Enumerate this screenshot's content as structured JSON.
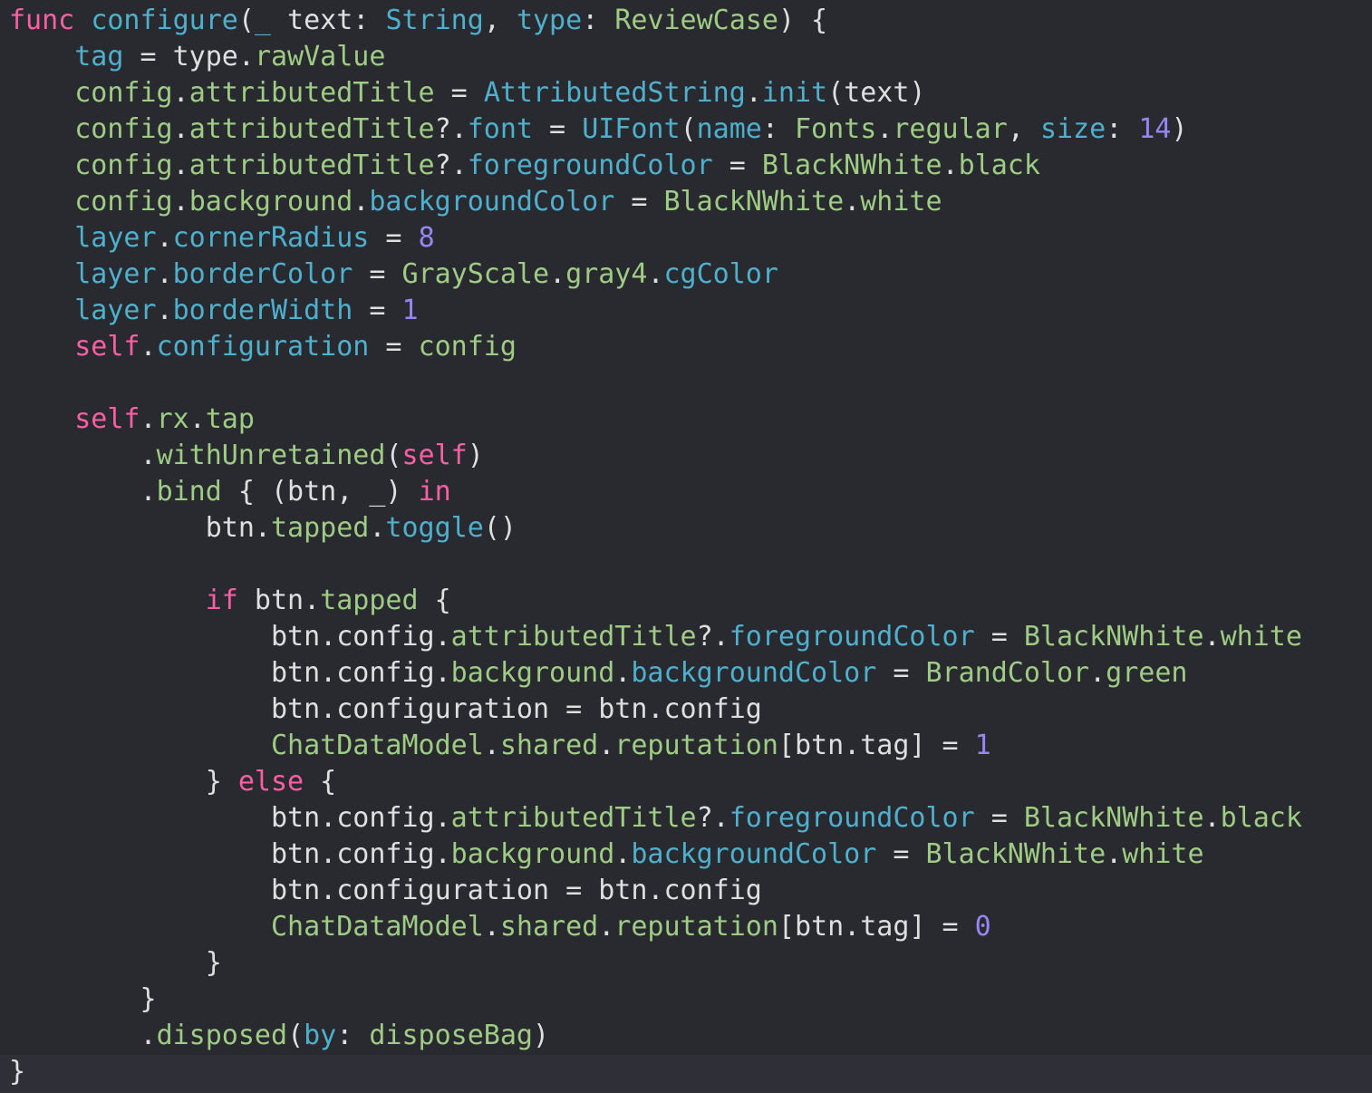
{
  "editor": {
    "theme": {
      "background": "#292a30",
      "current_line": "#2f3037",
      "plain": "#dfdfe0",
      "keyword": "#fc5fa3",
      "type_decl": "#5dd8ff",
      "function_decl": "#41a1c0",
      "property_project": "#67b7a4",
      "other_type": "#a1d28c",
      "property_other": "#a8d7c9",
      "number": "#d0bf69"
    },
    "lines": [
      [
        {
          "c": "kw",
          "t": "func"
        },
        {
          "c": "plain",
          "t": " "
        },
        {
          "c": "fn",
          "t": "configure"
        },
        {
          "c": "plain",
          "t": "("
        },
        {
          "c": "fn",
          "t": "_"
        },
        {
          "c": "plain",
          "t": " text: "
        },
        {
          "c": "type",
          "t": "String"
        },
        {
          "c": "plain",
          "t": ", "
        },
        {
          "c": "fn",
          "t": "type"
        },
        {
          "c": "plain",
          "t": ": "
        },
        {
          "c": "ot",
          "t": "ReviewCase"
        },
        {
          "c": "plain",
          "t": ") {"
        }
      ],
      [
        {
          "c": "plain",
          "t": "    "
        },
        {
          "c": "fn",
          "t": "tag"
        },
        {
          "c": "plain",
          "t": " = type."
        },
        {
          "c": "po",
          "t": "rawValue"
        }
      ],
      [
        {
          "c": "plain",
          "t": "    "
        },
        {
          "c": "po",
          "t": "config"
        },
        {
          "c": "plain",
          "t": "."
        },
        {
          "c": "po",
          "t": "attributedTitle"
        },
        {
          "c": "plain",
          "t": " = "
        },
        {
          "c": "fn",
          "t": "AttributedString"
        },
        {
          "c": "plain",
          "t": "."
        },
        {
          "c": "fn",
          "t": "init"
        },
        {
          "c": "plain",
          "t": "(text)"
        }
      ],
      [
        {
          "c": "plain",
          "t": "    "
        },
        {
          "c": "po",
          "t": "config"
        },
        {
          "c": "plain",
          "t": "."
        },
        {
          "c": "po",
          "t": "attributedTitle"
        },
        {
          "c": "plain",
          "t": "?."
        },
        {
          "c": "fn",
          "t": "font"
        },
        {
          "c": "plain",
          "t": " = "
        },
        {
          "c": "fn",
          "t": "UIFont"
        },
        {
          "c": "plain",
          "t": "("
        },
        {
          "c": "fn",
          "t": "name"
        },
        {
          "c": "plain",
          "t": ": "
        },
        {
          "c": "ot",
          "t": "Fonts"
        },
        {
          "c": "plain",
          "t": "."
        },
        {
          "c": "po",
          "t": "regular"
        },
        {
          "c": "plain",
          "t": ", "
        },
        {
          "c": "fn",
          "t": "size"
        },
        {
          "c": "plain",
          "t": ": "
        },
        {
          "c": "num",
          "t": "14"
        },
        {
          "c": "plain",
          "t": ")"
        }
      ],
      [
        {
          "c": "plain",
          "t": "    "
        },
        {
          "c": "po",
          "t": "config"
        },
        {
          "c": "plain",
          "t": "."
        },
        {
          "c": "po",
          "t": "attributedTitle"
        },
        {
          "c": "plain",
          "t": "?."
        },
        {
          "c": "fn",
          "t": "foregroundColor"
        },
        {
          "c": "plain",
          "t": " = "
        },
        {
          "c": "ot",
          "t": "BlackNWhite"
        },
        {
          "c": "plain",
          "t": "."
        },
        {
          "c": "po",
          "t": "black"
        }
      ],
      [
        {
          "c": "plain",
          "t": "    "
        },
        {
          "c": "po",
          "t": "config"
        },
        {
          "c": "plain",
          "t": "."
        },
        {
          "c": "po",
          "t": "background"
        },
        {
          "c": "plain",
          "t": "."
        },
        {
          "c": "fn",
          "t": "backgroundColor"
        },
        {
          "c": "plain",
          "t": " = "
        },
        {
          "c": "ot",
          "t": "BlackNWhite"
        },
        {
          "c": "plain",
          "t": "."
        },
        {
          "c": "po",
          "t": "white"
        }
      ],
      [
        {
          "c": "plain",
          "t": "    "
        },
        {
          "c": "fn",
          "t": "layer"
        },
        {
          "c": "plain",
          "t": "."
        },
        {
          "c": "fn",
          "t": "cornerRadius"
        },
        {
          "c": "plain",
          "t": " = "
        },
        {
          "c": "num",
          "t": "8"
        }
      ],
      [
        {
          "c": "plain",
          "t": "    "
        },
        {
          "c": "fn",
          "t": "layer"
        },
        {
          "c": "plain",
          "t": "."
        },
        {
          "c": "fn",
          "t": "borderColor"
        },
        {
          "c": "plain",
          "t": " = "
        },
        {
          "c": "ot",
          "t": "GrayScale"
        },
        {
          "c": "plain",
          "t": "."
        },
        {
          "c": "po",
          "t": "gray4"
        },
        {
          "c": "plain",
          "t": "."
        },
        {
          "c": "fn",
          "t": "cgColor"
        }
      ],
      [
        {
          "c": "plain",
          "t": "    "
        },
        {
          "c": "fn",
          "t": "layer"
        },
        {
          "c": "plain",
          "t": "."
        },
        {
          "c": "fn",
          "t": "borderWidth"
        },
        {
          "c": "plain",
          "t": " = "
        },
        {
          "c": "num",
          "t": "1"
        }
      ],
      [
        {
          "c": "plain",
          "t": "    "
        },
        {
          "c": "kw",
          "t": "self"
        },
        {
          "c": "plain",
          "t": "."
        },
        {
          "c": "fn",
          "t": "configuration"
        },
        {
          "c": "plain",
          "t": " = "
        },
        {
          "c": "po",
          "t": "config"
        }
      ],
      [
        {
          "c": "plain",
          "t": ""
        }
      ],
      [
        {
          "c": "plain",
          "t": "    "
        },
        {
          "c": "kw",
          "t": "self"
        },
        {
          "c": "plain",
          "t": "."
        },
        {
          "c": "po",
          "t": "rx"
        },
        {
          "c": "plain",
          "t": "."
        },
        {
          "c": "po",
          "t": "tap"
        }
      ],
      [
        {
          "c": "plain",
          "t": "        ."
        },
        {
          "c": "po",
          "t": "withUnretained"
        },
        {
          "c": "plain",
          "t": "("
        },
        {
          "c": "kw",
          "t": "self"
        },
        {
          "c": "plain",
          "t": ")"
        }
      ],
      [
        {
          "c": "plain",
          "t": "        ."
        },
        {
          "c": "po",
          "t": "bind"
        },
        {
          "c": "plain",
          "t": " { (btn, _) "
        },
        {
          "c": "kw",
          "t": "in"
        }
      ],
      [
        {
          "c": "plain",
          "t": "            btn."
        },
        {
          "c": "po",
          "t": "tapped"
        },
        {
          "c": "plain",
          "t": "."
        },
        {
          "c": "fn",
          "t": "toggle"
        },
        {
          "c": "plain",
          "t": "()"
        }
      ],
      [
        {
          "c": "plain",
          "t": ""
        }
      ],
      [
        {
          "c": "plain",
          "t": "            "
        },
        {
          "c": "kw",
          "t": "if"
        },
        {
          "c": "plain",
          "t": " btn."
        },
        {
          "c": "po",
          "t": "tapped"
        },
        {
          "c": "plain",
          "t": " {"
        }
      ],
      [
        {
          "c": "plain",
          "t": "                btn.config."
        },
        {
          "c": "po",
          "t": "attributedTitle"
        },
        {
          "c": "plain",
          "t": "?."
        },
        {
          "c": "fn",
          "t": "foregroundColor"
        },
        {
          "c": "plain",
          "t": " = "
        },
        {
          "c": "ot",
          "t": "BlackNWhite"
        },
        {
          "c": "plain",
          "t": "."
        },
        {
          "c": "po",
          "t": "white"
        }
      ],
      [
        {
          "c": "plain",
          "t": "                btn.config."
        },
        {
          "c": "po",
          "t": "background"
        },
        {
          "c": "plain",
          "t": "."
        },
        {
          "c": "fn",
          "t": "backgroundColor"
        },
        {
          "c": "plain",
          "t": " = "
        },
        {
          "c": "ot",
          "t": "BrandColor"
        },
        {
          "c": "plain",
          "t": "."
        },
        {
          "c": "po",
          "t": "green"
        }
      ],
      [
        {
          "c": "plain",
          "t": "                btn.configuration = btn.config"
        }
      ],
      [
        {
          "c": "plain",
          "t": "                "
        },
        {
          "c": "ot",
          "t": "ChatDataModel"
        },
        {
          "c": "plain",
          "t": "."
        },
        {
          "c": "po",
          "t": "shared"
        },
        {
          "c": "plain",
          "t": "."
        },
        {
          "c": "po",
          "t": "reputation"
        },
        {
          "c": "plain",
          "t": "[btn.tag] = "
        },
        {
          "c": "num",
          "t": "1"
        }
      ],
      [
        {
          "c": "plain",
          "t": "            } "
        },
        {
          "c": "kw",
          "t": "else"
        },
        {
          "c": "plain",
          "t": " {"
        }
      ],
      [
        {
          "c": "plain",
          "t": "                btn.config."
        },
        {
          "c": "po",
          "t": "attributedTitle"
        },
        {
          "c": "plain",
          "t": "?."
        },
        {
          "c": "fn",
          "t": "foregroundColor"
        },
        {
          "c": "plain",
          "t": " = "
        },
        {
          "c": "ot",
          "t": "BlackNWhite"
        },
        {
          "c": "plain",
          "t": "."
        },
        {
          "c": "po",
          "t": "black"
        }
      ],
      [
        {
          "c": "plain",
          "t": "                btn.config."
        },
        {
          "c": "po",
          "t": "background"
        },
        {
          "c": "plain",
          "t": "."
        },
        {
          "c": "fn",
          "t": "backgroundColor"
        },
        {
          "c": "plain",
          "t": " = "
        },
        {
          "c": "ot",
          "t": "BlackNWhite"
        },
        {
          "c": "plain",
          "t": "."
        },
        {
          "c": "po",
          "t": "white"
        }
      ],
      [
        {
          "c": "plain",
          "t": "                btn.configuration = btn.config"
        }
      ],
      [
        {
          "c": "plain",
          "t": "                "
        },
        {
          "c": "ot",
          "t": "ChatDataModel"
        },
        {
          "c": "plain",
          "t": "."
        },
        {
          "c": "po",
          "t": "shared"
        },
        {
          "c": "plain",
          "t": "."
        },
        {
          "c": "po",
          "t": "reputation"
        },
        {
          "c": "plain",
          "t": "[btn.tag] = "
        },
        {
          "c": "num",
          "t": "0"
        }
      ],
      [
        {
          "c": "plain",
          "t": "            }"
        }
      ],
      [
        {
          "c": "plain",
          "t": "        }"
        }
      ],
      [
        {
          "c": "plain",
          "t": "        ."
        },
        {
          "c": "po",
          "t": "disposed"
        },
        {
          "c": "plain",
          "t": "("
        },
        {
          "c": "fn",
          "t": "by"
        },
        {
          "c": "plain",
          "t": ": "
        },
        {
          "c": "po",
          "t": "disposeBag"
        },
        {
          "c": "plain",
          "t": ")"
        }
      ],
      [
        {
          "c": "plain",
          "t": "}"
        }
      ]
    ]
  }
}
